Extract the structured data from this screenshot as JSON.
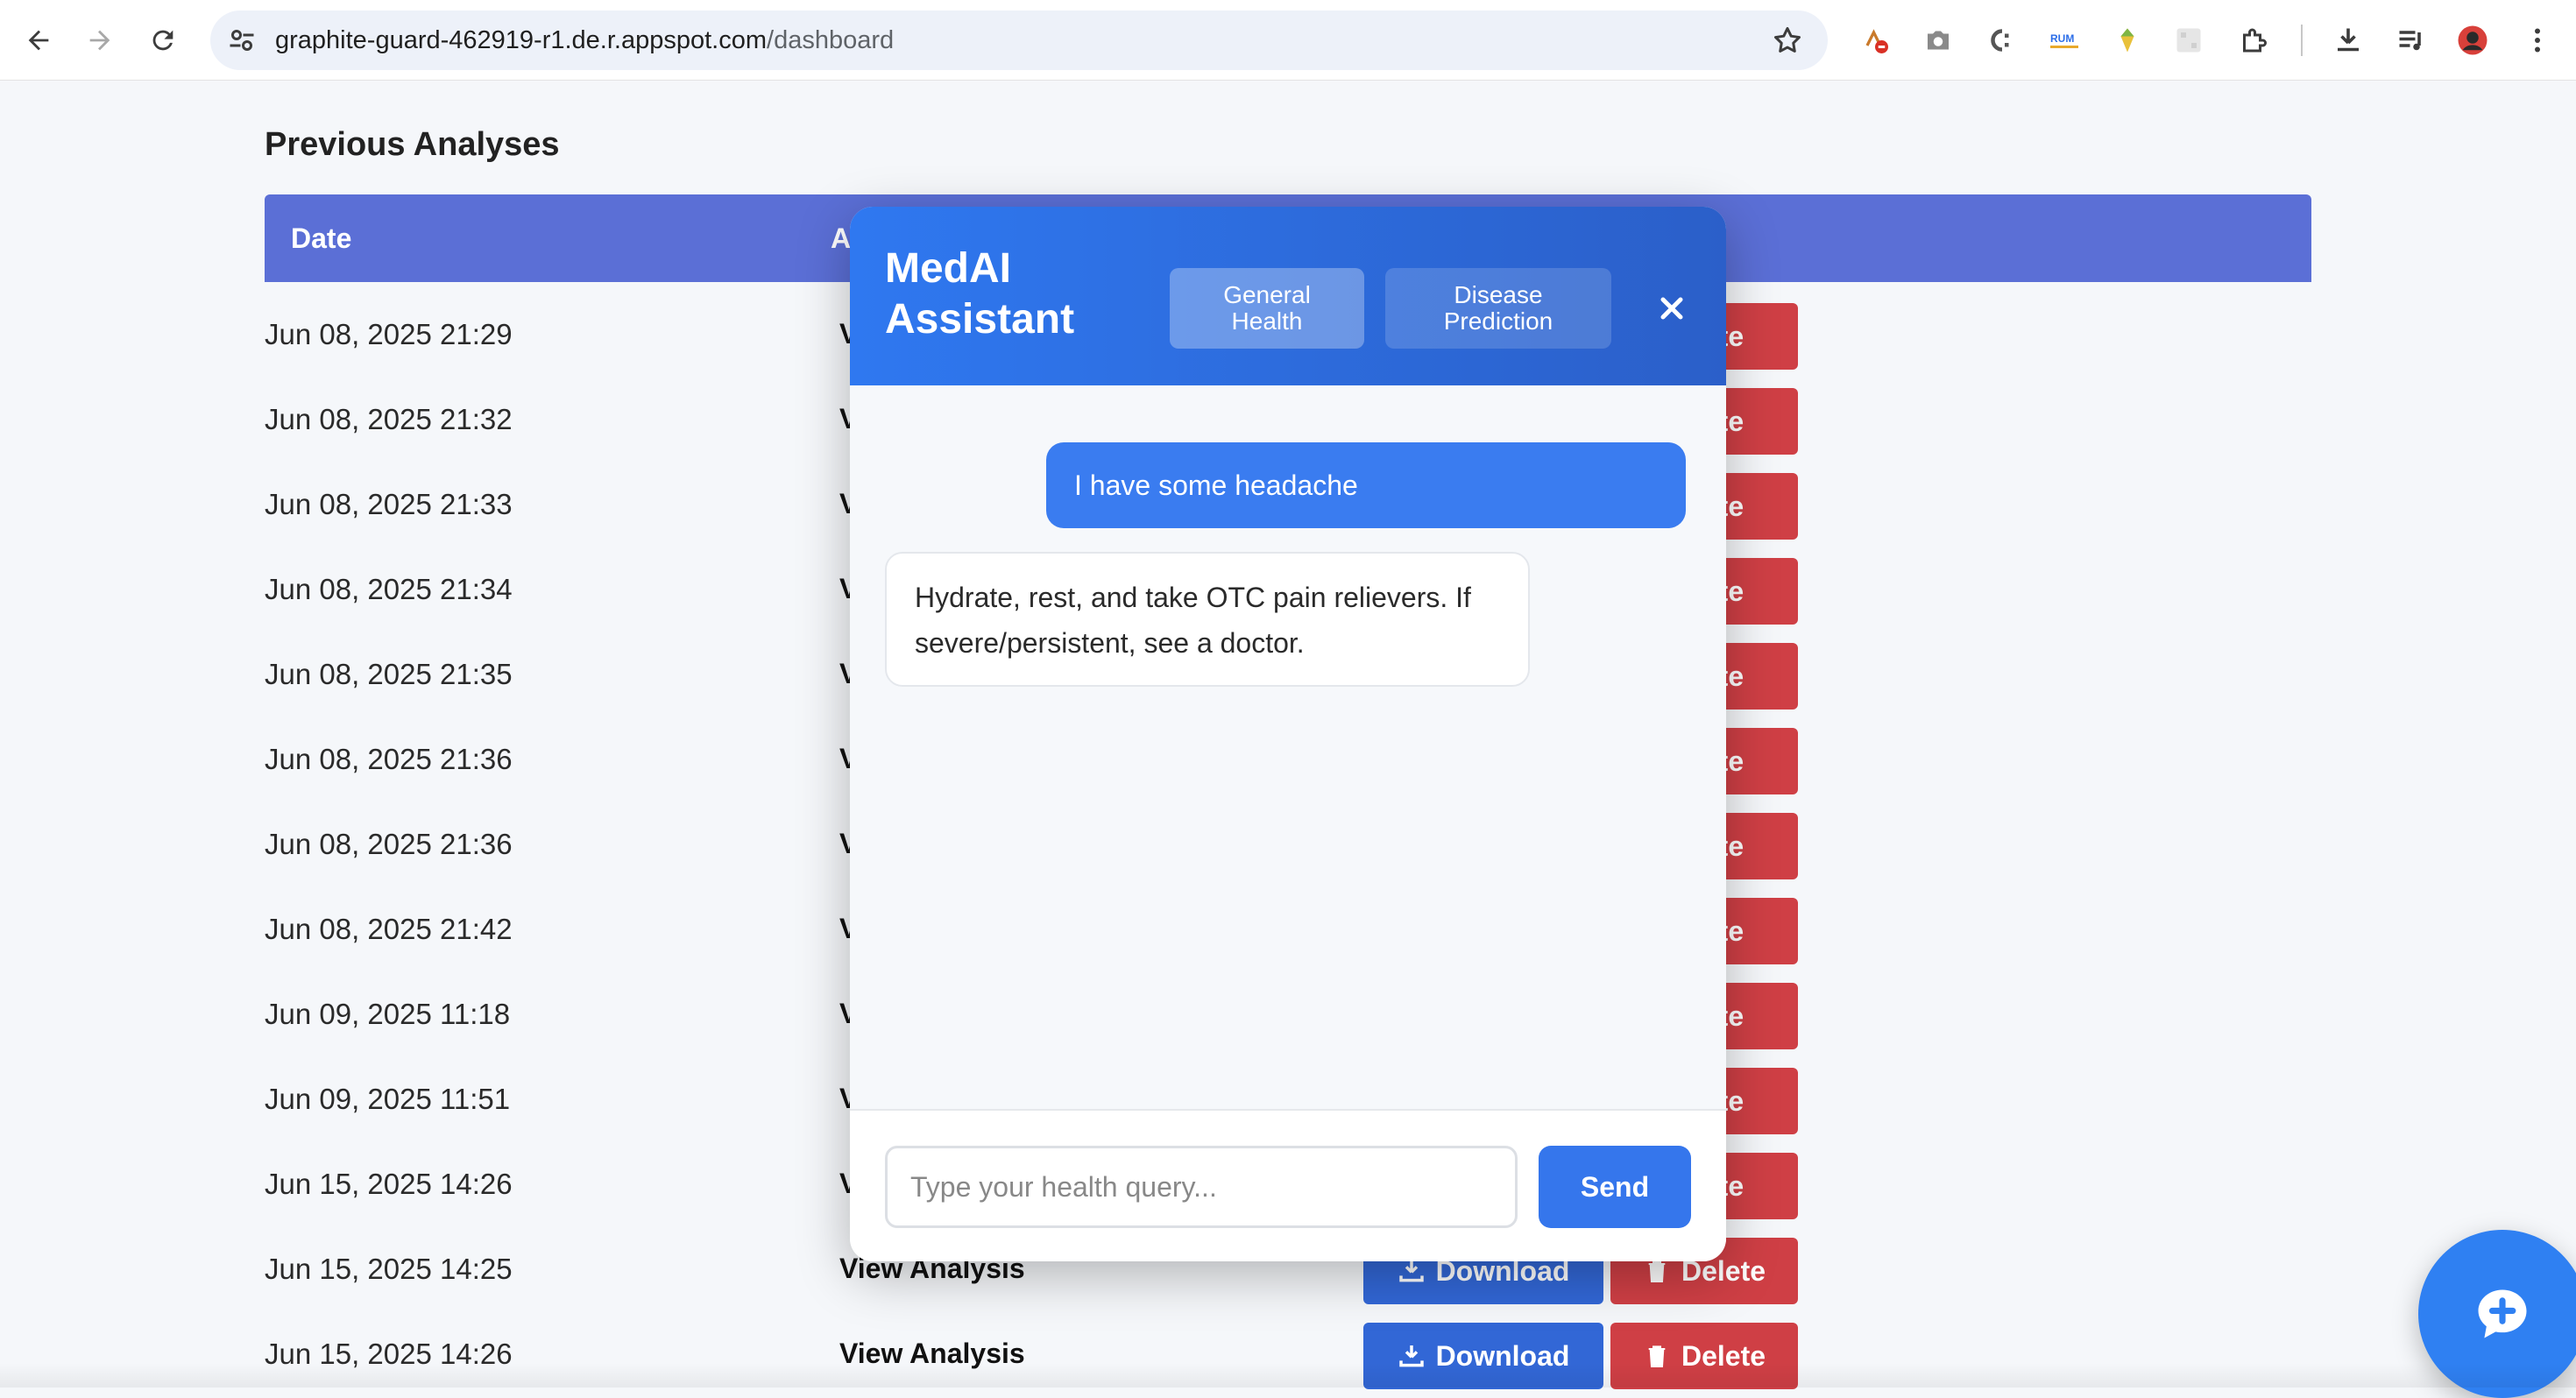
{
  "browser": {
    "url_host": "graphite-guard-462919-r1.de.r.appspot.com",
    "url_path": "/dashboard",
    "extensions": [
      "ext-a-icon",
      "camera-icon",
      "code-icon",
      "rum-icon",
      "gem-icon",
      "grid-icon",
      "puzzle-icon",
      "download-icon",
      "media-icon",
      "avatar",
      "more-icon"
    ],
    "rum_label": "RUM"
  },
  "page": {
    "title": "Previous Analyses",
    "columns": [
      "Date",
      "A"
    ]
  },
  "rows": [
    {
      "date": "Jun 08, 2025 21:29",
      "view": "V",
      "download": "",
      "delete": "ete"
    },
    {
      "date": "Jun 08, 2025 21:32",
      "view": "V",
      "download": "",
      "delete": "ete"
    },
    {
      "date": "Jun 08, 2025 21:33",
      "view": "V",
      "download": "",
      "delete": "ete"
    },
    {
      "date": "Jun 08, 2025 21:34",
      "view": "V",
      "download": "",
      "delete": "ete"
    },
    {
      "date": "Jun 08, 2025 21:35",
      "view": "V",
      "download": "",
      "delete": "ete"
    },
    {
      "date": "Jun 08, 2025 21:36",
      "view": "V",
      "download": "",
      "delete": "ete"
    },
    {
      "date": "Jun 08, 2025 21:36",
      "view": "V",
      "download": "",
      "delete": "ete"
    },
    {
      "date": "Jun 08, 2025 21:42",
      "view": "V",
      "download": "",
      "delete": "ete"
    },
    {
      "date": "Jun 09, 2025 11:18",
      "view": "V",
      "download": "",
      "delete": "ete"
    },
    {
      "date": "Jun 09, 2025 11:51",
      "view": "V",
      "download": "",
      "delete": "ete"
    },
    {
      "date": "Jun 15, 2025 14:26",
      "view": "V",
      "download": "",
      "delete": "ete"
    },
    {
      "date": "Jun 15, 2025 14:25",
      "view": "View Analysis",
      "download": "Download",
      "delete": "Delete"
    },
    {
      "date": "Jun 15, 2025 14:26",
      "view": "View Analysis",
      "download": "Download",
      "delete": "Delete"
    }
  ],
  "chat": {
    "title": "MedAI Assistant",
    "modes": [
      "General Health",
      "Disease Prediction"
    ],
    "active_mode": "General Health",
    "messages": [
      {
        "role": "user",
        "text": "I have some headache"
      },
      {
        "role": "assistant",
        "text": "Hydrate, rest, and take OTC pain relievers. If severe/persistent, see a doctor."
      }
    ],
    "input_placeholder": "Type your health query...",
    "input_value": "",
    "send_label": "Send"
  },
  "colors": {
    "header": "#5b6fd6",
    "download": "#3267d6",
    "delete": "#cf3f45",
    "chat_accent": "#2f78f0",
    "fab": "#2f80f2"
  }
}
